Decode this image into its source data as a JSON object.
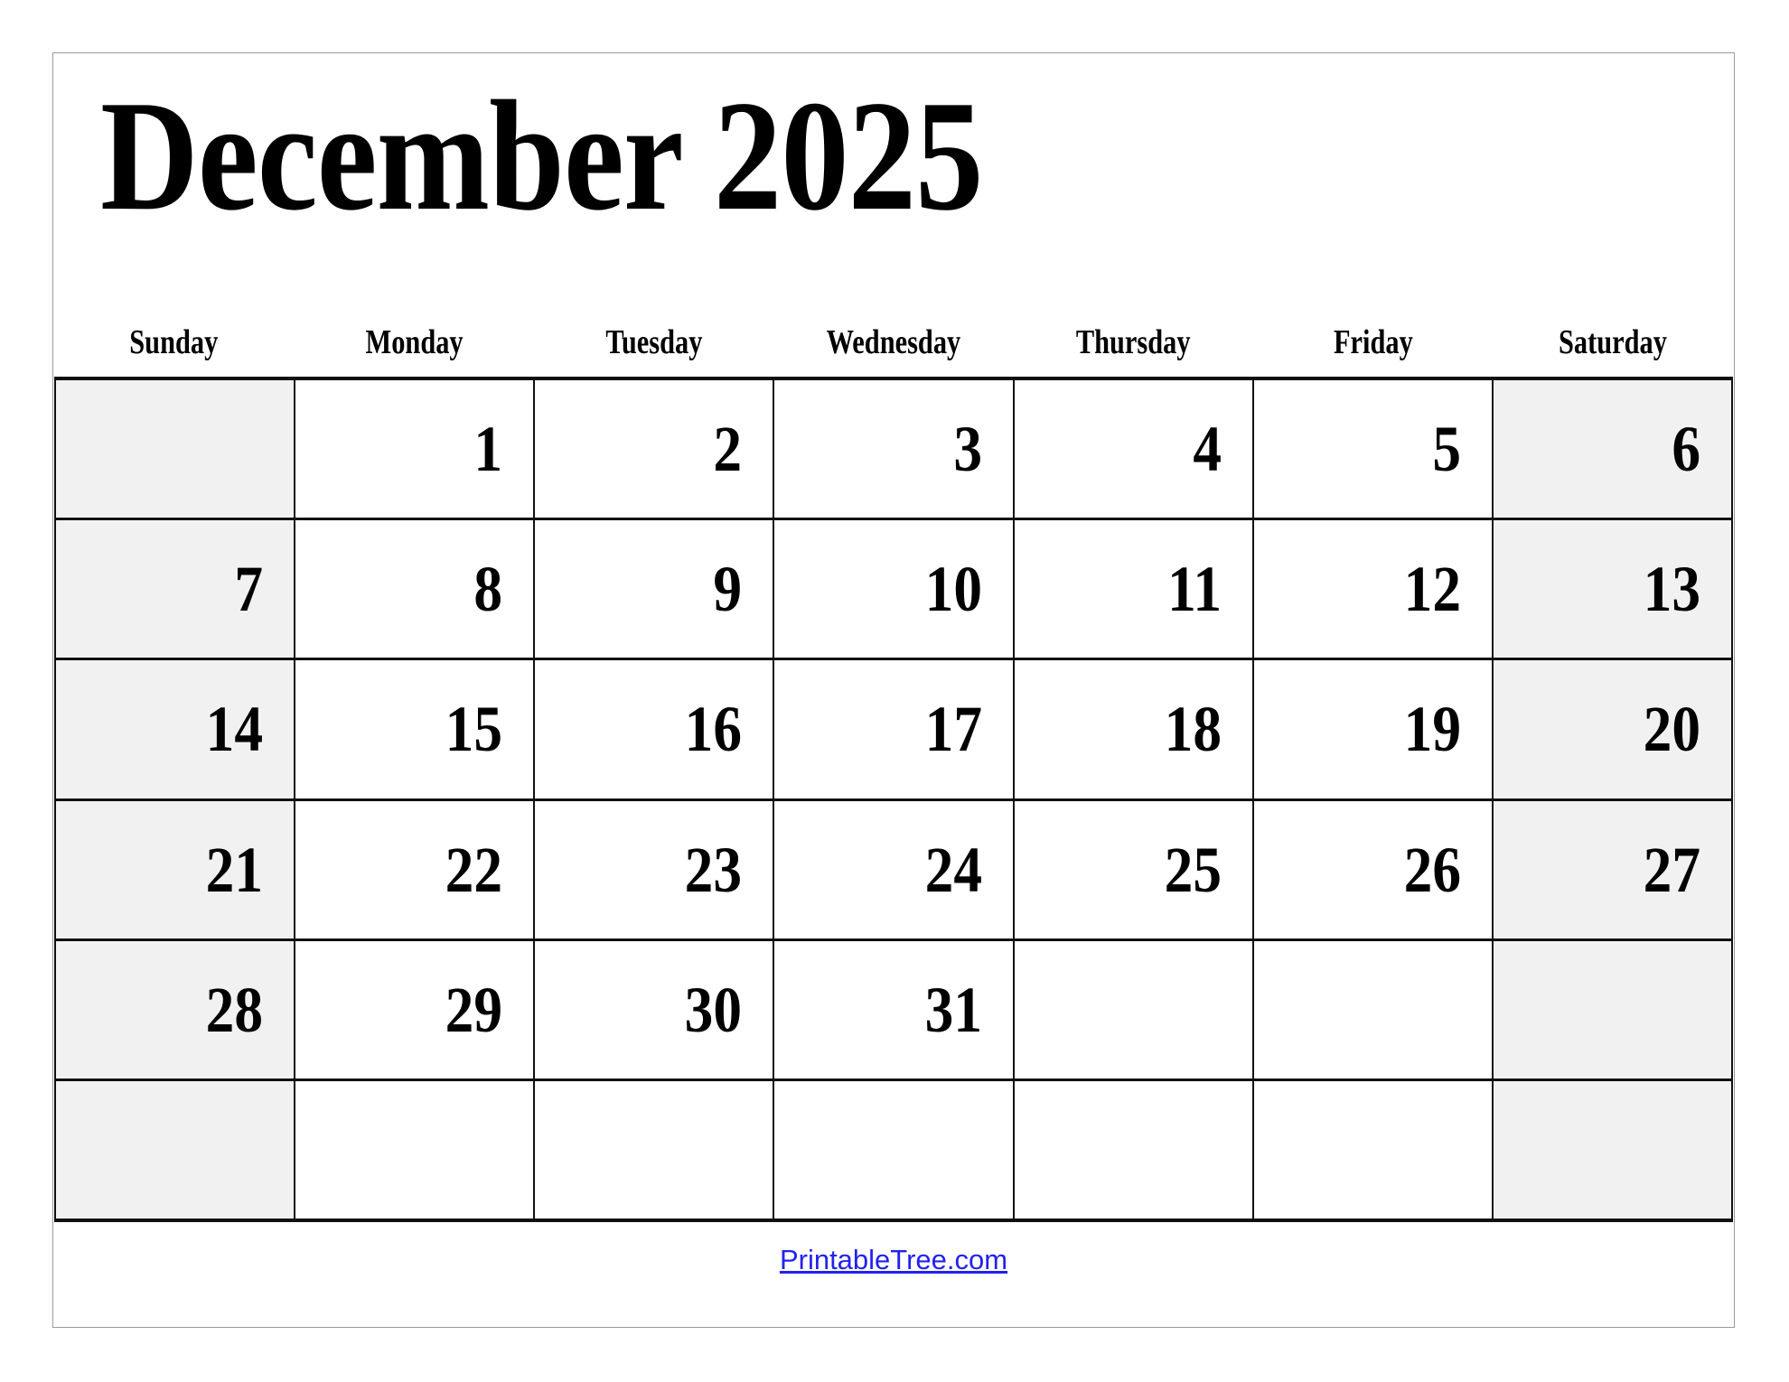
{
  "document": {
    "title": "December 2025",
    "month": "December",
    "year": "2025"
  },
  "weekdays": [
    {
      "label": "Sunday",
      "weekend": true
    },
    {
      "label": "Monday",
      "weekend": false
    },
    {
      "label": "Tuesday",
      "weekend": false
    },
    {
      "label": "Wednesday",
      "weekend": false
    },
    {
      "label": "Thursday",
      "weekend": false
    },
    {
      "label": "Friday",
      "weekend": false
    },
    {
      "label": "Saturday",
      "weekend": true
    }
  ],
  "weeks": [
    [
      "",
      "1",
      "2",
      "3",
      "4",
      "5",
      "6"
    ],
    [
      "7",
      "8",
      "9",
      "10",
      "11",
      "12",
      "13"
    ],
    [
      "14",
      "15",
      "16",
      "17",
      "18",
      "19",
      "20"
    ],
    [
      "21",
      "22",
      "23",
      "24",
      "25",
      "26",
      "27"
    ],
    [
      "28",
      "29",
      "30",
      "31",
      "",
      "",
      ""
    ],
    [
      "",
      "",
      "",
      "",
      "",
      "",
      ""
    ]
  ],
  "footer": {
    "link_text": "PrintableTree.com"
  },
  "colors": {
    "weekend_background": "#f1f1f1",
    "weekday_background": "#ffffff",
    "grid_line": "#111111",
    "page_border": "#9a9a9a",
    "text": "#000000",
    "link": "#2222ee"
  }
}
